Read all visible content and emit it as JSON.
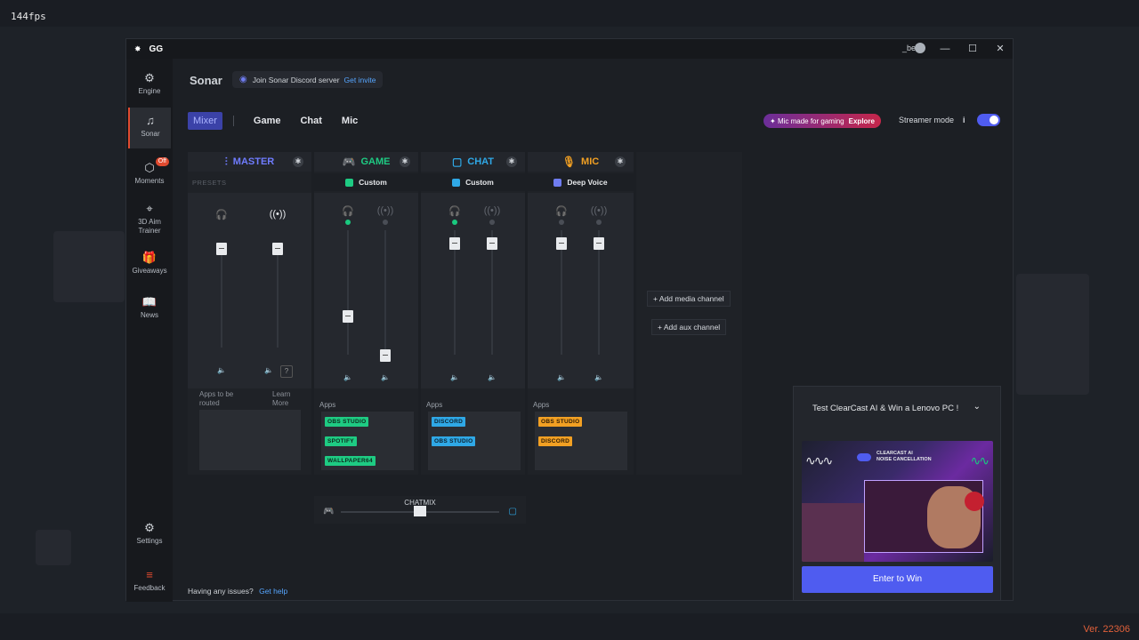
{
  "overlay": {
    "fps": "144fps",
    "version": "Ver. 22306"
  },
  "titlebar": {
    "app": "GG",
    "user": "_be5",
    "minimize": "—",
    "maximize": "☐",
    "close": "✕"
  },
  "sidebar": {
    "items": [
      {
        "label": "Engine",
        "icon": "⚙"
      },
      {
        "label": "Sonar",
        "icon": "♫"
      },
      {
        "label": "Moments",
        "icon": "⬡",
        "badge": "Off"
      },
      {
        "label": "3D Aim\nTrainer",
        "icon": "⌖"
      },
      {
        "label": "Giveaways",
        "icon": "🎁"
      },
      {
        "label": "News",
        "icon": "📖"
      },
      {
        "label": "Settings",
        "icon": "⚙"
      },
      {
        "label": "Feedback",
        "icon": "≡"
      }
    ]
  },
  "header": {
    "title": "Sonar",
    "discord_text": "Join Sonar Discord server",
    "discord_link": "Get invite"
  },
  "tabs": [
    "Mixer",
    "Game",
    "Chat",
    "Mic"
  ],
  "promo": {
    "text": "Mic made for gaming",
    "cta": "Explore"
  },
  "streamer_mode": {
    "label": "Streamer mode",
    "info": "i",
    "enabled": true
  },
  "channels": {
    "master": {
      "name": "MASTER",
      "presets": "PRESETS",
      "note_left": "Apps to be routed",
      "note_right": "Learn More",
      "q": "?"
    },
    "game": {
      "name": "GAME",
      "preset": "Custom",
      "apps_label": "Apps",
      "apps": [
        "OBS STUDIO",
        "SPOTIFY",
        "WALLPAPER64"
      ]
    },
    "chat": {
      "name": "CHAT",
      "preset": "Custom",
      "apps_label": "Apps",
      "apps": [
        "DISCORD",
        "OBS STUDIO"
      ]
    },
    "mic": {
      "name": "MIC",
      "preset": "Deep Voice",
      "apps_label": "Apps",
      "apps": [
        "OBS STUDIO",
        "DISCORD"
      ]
    }
  },
  "add_media": "+ Add media channel",
  "add_aux": "+ Add aux channel",
  "chatmix": {
    "label": "CHATMIX"
  },
  "issues": {
    "text": "Having any issues?",
    "link": "Get help"
  },
  "popup": {
    "title": "Test ClearCast AI & Win a Lenovo PC !",
    "image_text": "CLEARCAST AI\nNOISE CANCELLATION",
    "button": "Enter to Win"
  },
  "colors": {
    "accent": "#4f5cf0",
    "game": "#1ecb83",
    "chat": "#2fa8e6",
    "mic": "#f2a023",
    "master": "#6f7cff",
    "brand": "#e04a2f"
  }
}
